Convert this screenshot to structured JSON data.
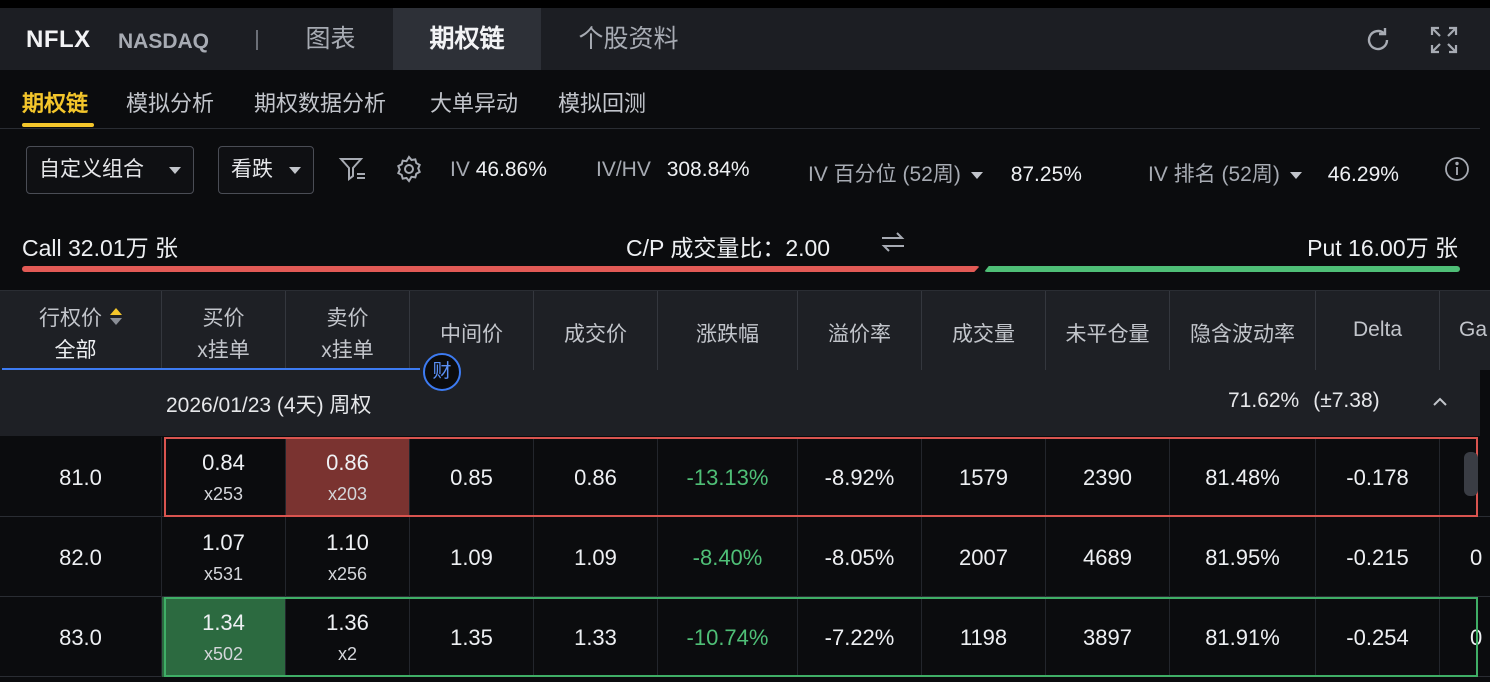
{
  "header": {
    "symbol": "NFLX",
    "exchange": "NASDAQ",
    "tabs": [
      {
        "label": "图表"
      },
      {
        "label": "期权链"
      },
      {
        "label": "个股资料"
      }
    ]
  },
  "subtabs": [
    {
      "label": "期权链"
    },
    {
      "label": "模拟分析"
    },
    {
      "label": "期权数据分析"
    },
    {
      "label": "大单异动"
    },
    {
      "label": "模拟回测"
    }
  ],
  "filters": {
    "strategy": "自定义组合",
    "direction": "看跌",
    "iv_label": "IV",
    "iv_value": "46.86%",
    "ivhv_label": "IV/HV",
    "ivhv_value": "308.84%",
    "ivpct_label": "IV 百分位 (52周)",
    "ivpct_value": "87.25%",
    "ivrank_label": "IV 排名 (52周)",
    "ivrank_value": "46.29%"
  },
  "volume_bar": {
    "call_text": "Call 32.01万 张",
    "ratio_text": "C/P 成交量比：2.00",
    "put_text": "Put 16.00万 张",
    "call_share": 0.667,
    "call_color": "#e25a55",
    "put_color": "#4fbf77"
  },
  "table": {
    "headers": {
      "strike": "行权价",
      "strike_filter": "全部",
      "bid_l1": "买价",
      "bid_l2": "x挂单",
      "ask_l1": "卖价",
      "ask_l2": "x挂单",
      "mid": "中间价",
      "last": "成交价",
      "change": "涨跌幅",
      "premium": "溢价率",
      "volume": "成交量",
      "oi": "未平仓量",
      "iv": "隐含波动率",
      "delta": "Delta",
      "gamma_partial": "Ga"
    },
    "badge": "财",
    "group": {
      "date": "2026/01/23 (4天) 周权",
      "iv": "71.62%",
      "move": "(±7.38)"
    },
    "rows": [
      {
        "strike": "81.0",
        "bid": "0.84",
        "bid_size": "x253",
        "ask": "0.86",
        "ask_size": "x203",
        "mid": "0.85",
        "last": "0.86",
        "change": "-13.13%",
        "premium": "-8.92%",
        "volume": "1579",
        "oi": "2390",
        "iv": "81.48%",
        "delta": "-0.178",
        "gamma": ""
      },
      {
        "strike": "82.0",
        "bid": "1.07",
        "bid_size": "x531",
        "ask": "1.10",
        "ask_size": "x256",
        "mid": "1.09",
        "last": "1.09",
        "change": "-8.40%",
        "premium": "-8.05%",
        "volume": "2007",
        "oi": "4689",
        "iv": "81.95%",
        "delta": "-0.215",
        "gamma": "0"
      },
      {
        "strike": "83.0",
        "bid": "1.34",
        "bid_size": "x502",
        "ask": "1.36",
        "ask_size": "x2",
        "mid": "1.35",
        "last": "1.33",
        "change": "-10.74%",
        "premium": "-7.22%",
        "volume": "1198",
        "oi": "3897",
        "iv": "81.91%",
        "delta": "-0.254",
        "gamma": "0"
      }
    ]
  },
  "colors": {
    "accent_yellow": "#f4c62b",
    "positive_green": "#4fbf77",
    "negative_red": "#e25a55",
    "row1_outline": "#d9544f",
    "row3_outline": "#3fae66"
  }
}
